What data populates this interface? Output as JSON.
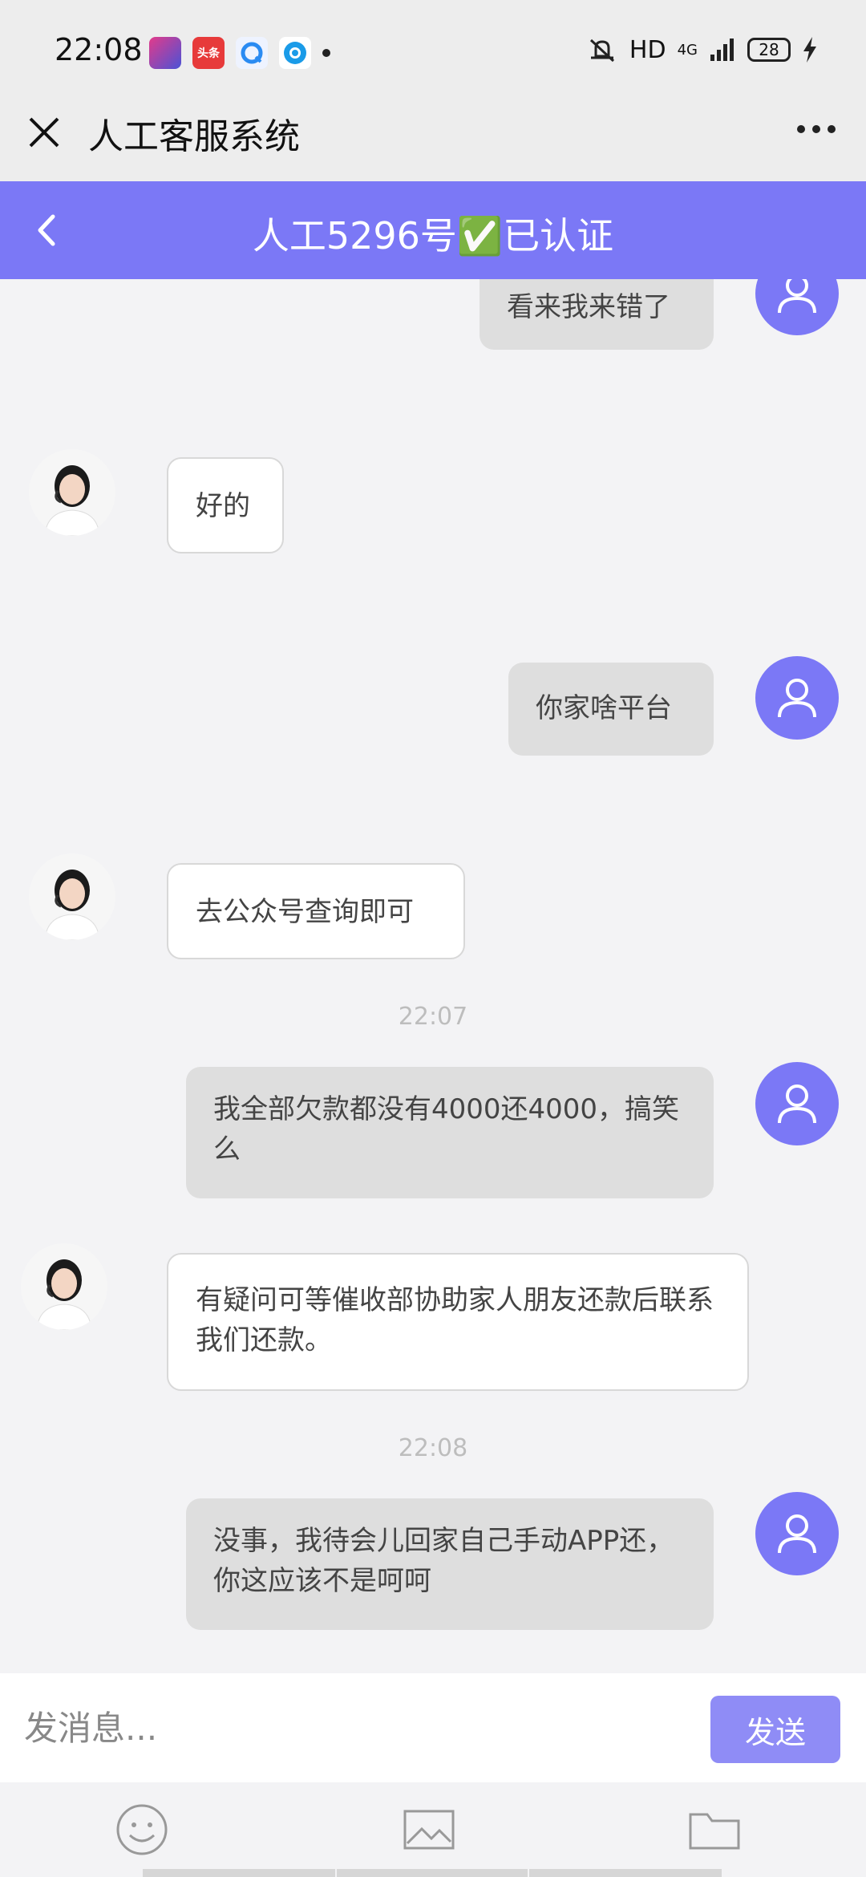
{
  "status_bar": {
    "time": "22:08",
    "app_b_label": "头条",
    "hd": "HD",
    "network": "4G",
    "battery": "28"
  },
  "title_bar": {
    "title": "人工客服系统"
  },
  "chat_header": {
    "title": "人工5296号✅已认证"
  },
  "messages": [
    {
      "sender": "user",
      "text": "看来我来错了"
    },
    {
      "sender": "agent",
      "text": "好的"
    },
    {
      "sender": "user",
      "text": "你家啥平台"
    },
    {
      "sender": "agent",
      "text": "去公众号查询即可"
    },
    {
      "sender": "timestamp",
      "text": "22:07"
    },
    {
      "sender": "user",
      "text": "我全部欠款都没有4000还4000，搞笑么"
    },
    {
      "sender": "agent",
      "text": "有疑问可等催收部协助家人朋友还款后联系我们还款。"
    },
    {
      "sender": "timestamp",
      "text": "22:08"
    },
    {
      "sender": "user",
      "text": "没事，我待会儿回家自己手动APP还，你这应该不是呵呵"
    }
  ],
  "input": {
    "placeholder": "发消息...",
    "send_label": "发送"
  },
  "colors": {
    "accent": "#7b78f6",
    "send_button": "#8f8cf6",
    "user_bubble": "#dedede",
    "agent_bubble": "#ffffff",
    "background": "#f3f3f5"
  },
  "toolbar": {
    "icons": [
      "smiley-icon",
      "image-icon",
      "folder-icon"
    ]
  }
}
